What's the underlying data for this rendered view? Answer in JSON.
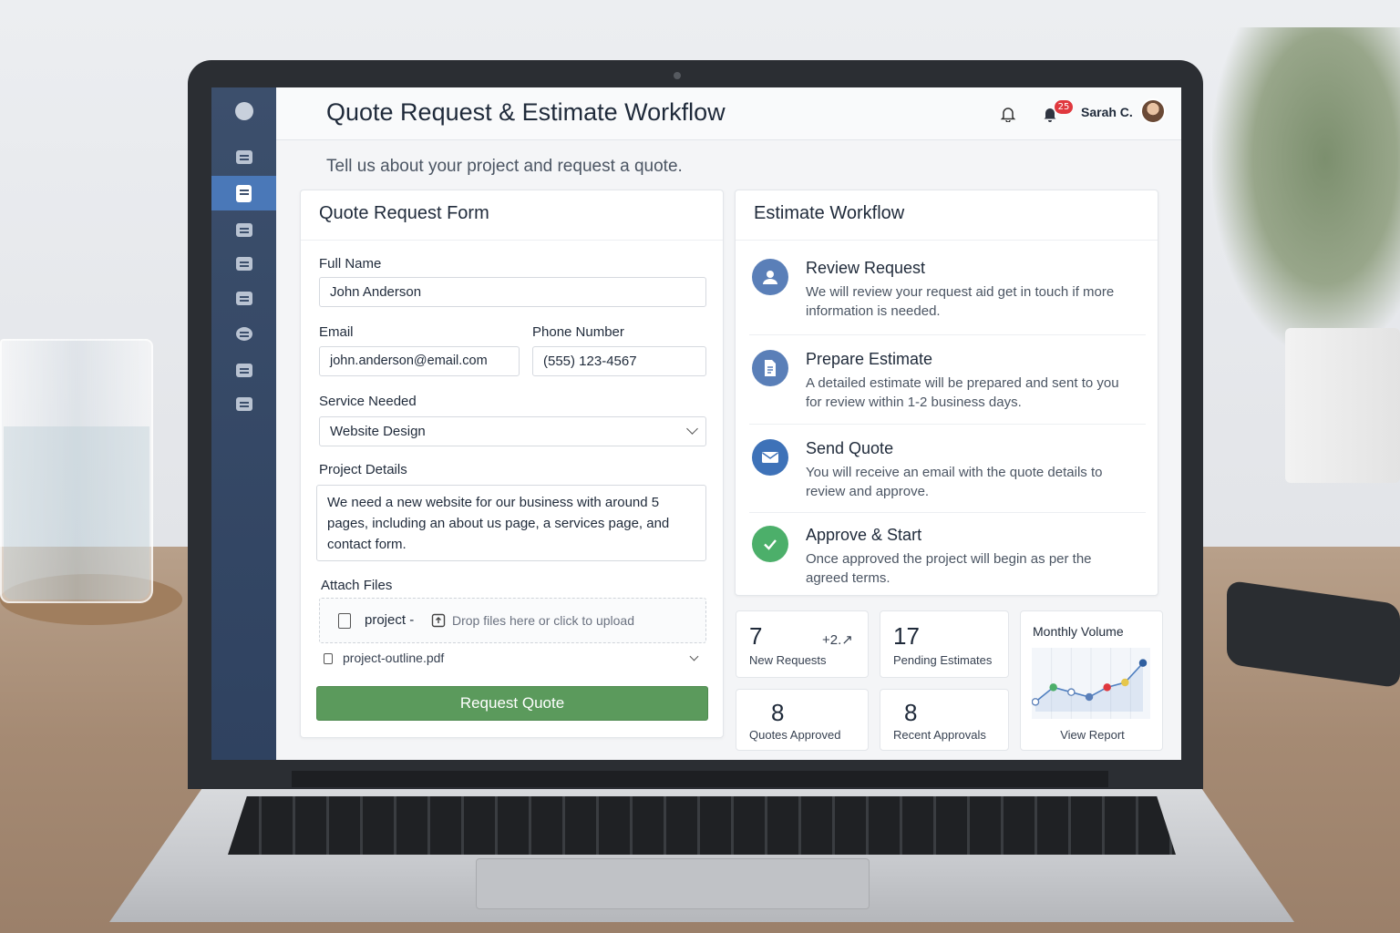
{
  "header": {
    "title": "Quote Request & Estimate Workflow",
    "notification_count": "25",
    "user_name": "Sarah C."
  },
  "subtitle": "Tell us about your project and request a quote.",
  "form": {
    "title": "Quote Request Form",
    "full_name_label": "Full Name",
    "full_name_value": "John Anderson",
    "email_label": "Email",
    "email_value": "john.anderson@email.com",
    "phone_label": "Phone Number",
    "phone_value": "(555) 123-4567",
    "service_label": "Service Needed",
    "service_value": "Website Design",
    "details_label": "Project Details",
    "details_value": "We need a new website for our business with around 5 pages, including an about us page, a services page, and contact form.",
    "attach_label": "Attach Files",
    "upload_file_name": "project -",
    "upload_hint": "Drop files here or click to upload",
    "attached_file": "project-outline.pdf",
    "submit_label": "Request Quote"
  },
  "workflow": {
    "title": "Estimate Workflow",
    "steps": [
      {
        "title": "Review Request",
        "desc": "We will review your request aid get in touch if more information is needed.",
        "color": "#5a7fb8"
      },
      {
        "title": "Prepare Estimate",
        "desc": "A detailed estimate will be prepared and sent to you for review within 1-2 business days.",
        "color": "#5a7fb8"
      },
      {
        "title": "Send Quote",
        "desc": "You will receive an email with the quote details to review and approve.",
        "color": "#3e72b8"
      },
      {
        "title": "Approve & Start",
        "desc": "Once approved the project will begin as per the agreed terms.",
        "color": "#4caf6a"
      }
    ]
  },
  "stats": [
    {
      "value": "7",
      "delta": "+2.↗",
      "label": "New Requests"
    },
    {
      "value": "17",
      "label": "Pending Estimates"
    },
    {
      "value": "8",
      "label": "Quotes Approved"
    },
    {
      "value": "8",
      "label": "Recent Approvals"
    }
  ],
  "chart": {
    "title": "Monthly Volume",
    "link": "View Report"
  },
  "chart_data": {
    "type": "line",
    "title": "Monthly Volume",
    "x": [
      1,
      2,
      3,
      4,
      5,
      6,
      7
    ],
    "series": [
      {
        "values": [
          2,
          5,
          4,
          3,
          5,
          6,
          10
        ]
      }
    ],
    "ylim": [
      0,
      12
    ],
    "point_colors": [
      "#5a7fb8",
      "#4caf6a",
      "#5a7fb8",
      "#5a7fb8",
      "#e0383e",
      "#e6c74c",
      "#2f5fa0"
    ]
  },
  "icons": [
    "bell-icon",
    "user-icon",
    "document-icon",
    "envelope-icon",
    "check-icon",
    "upload-icon",
    "file-icon",
    "chevron-down-icon"
  ]
}
